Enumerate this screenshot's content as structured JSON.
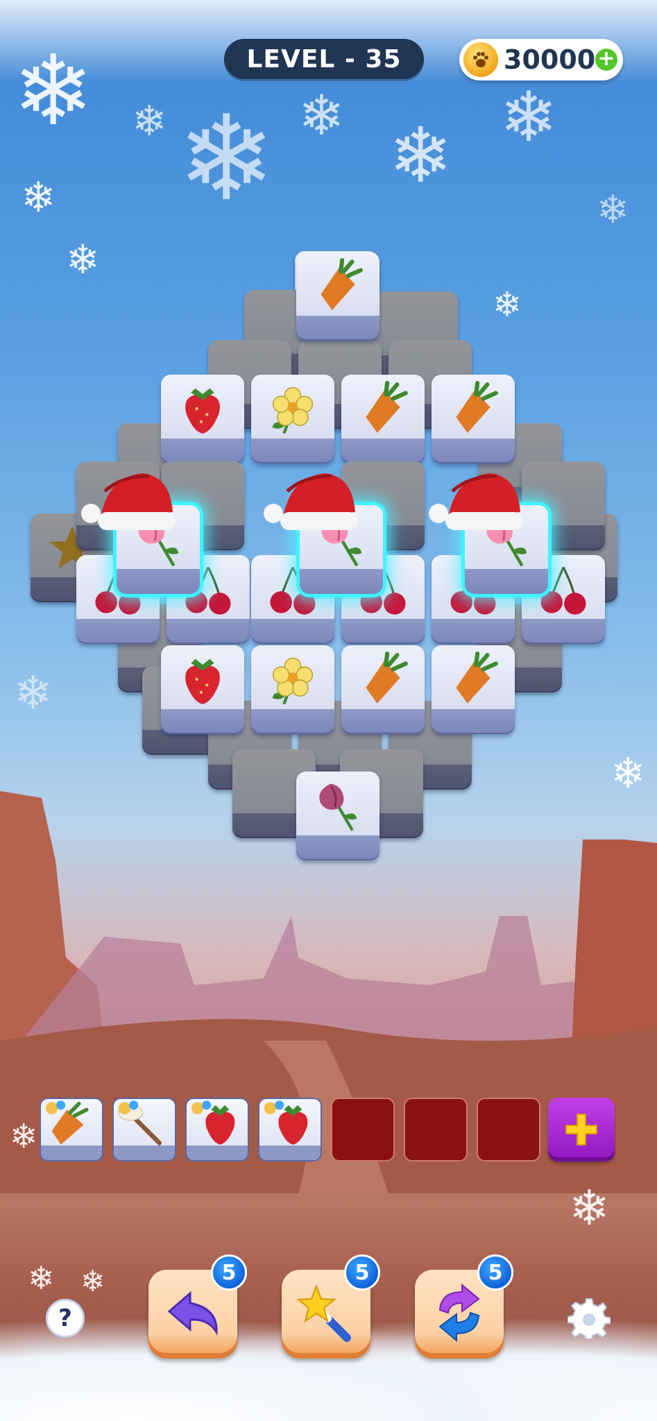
{
  "header": {
    "level_label": "LEVEL - 35",
    "coins": "30000",
    "coin_plus": "+"
  },
  "board": {
    "highlighted_tile_item": "rosebud",
    "highlighted_tile_count": 3,
    "hat": "santa-hat"
  },
  "tray": {
    "slots": [
      {
        "item": "carrot",
        "state": "filled"
      },
      {
        "item": "branch",
        "state": "filled"
      },
      {
        "item": "strawberry",
        "state": "filled"
      },
      {
        "item": "strawberry",
        "state": "filled"
      },
      {
        "item": "",
        "state": "empty"
      },
      {
        "item": "",
        "state": "empty"
      },
      {
        "item": "",
        "state": "empty"
      }
    ],
    "add_slot_label": "+"
  },
  "controls": {
    "help_label": "?",
    "undo_count": "5",
    "magic_count": "5",
    "shuffle_count": "5",
    "undo_icon": "undo-arrow-icon",
    "magic_icon": "magic-wand-icon",
    "shuffle_icon": "shuffle-icon",
    "settings_icon": "gear-icon"
  },
  "colors": {
    "level_pill": "#1f3552",
    "tile_glow": "#3ff3ff",
    "empty_slot": "#8b1010",
    "add_slot": "#a61fd0",
    "badge": "#0c5fd6",
    "booster": "#fcd2a6"
  }
}
